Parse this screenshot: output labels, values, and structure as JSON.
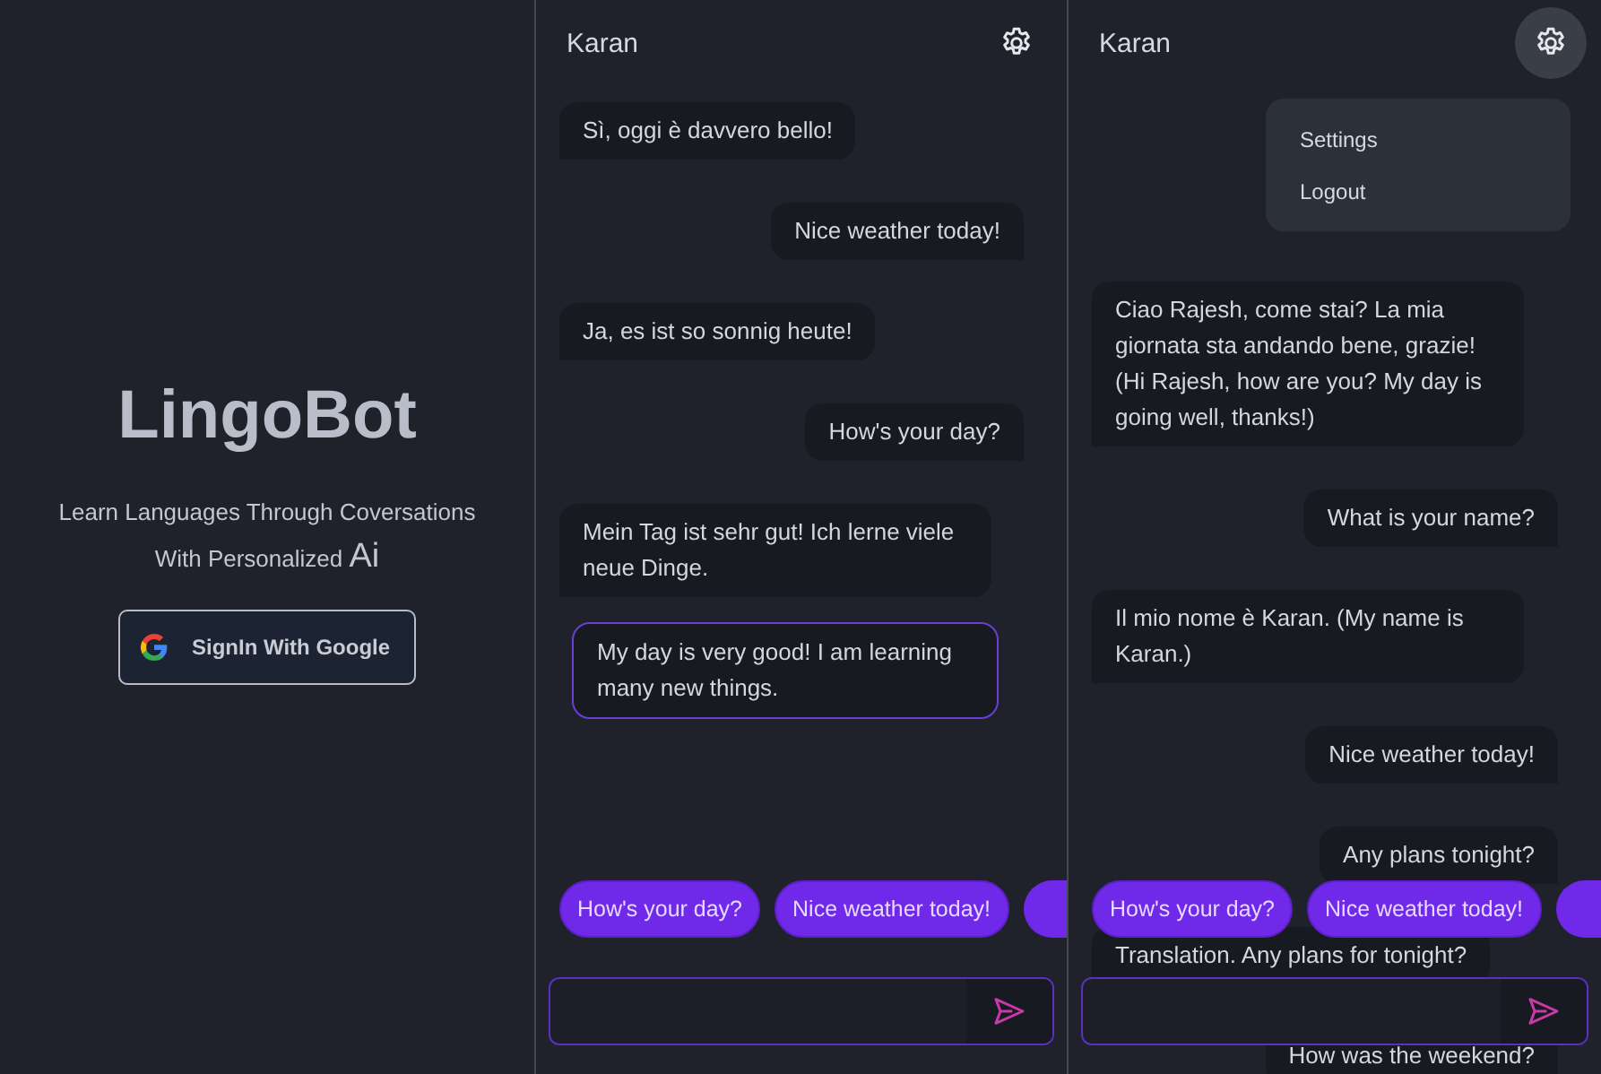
{
  "welcome": {
    "title": "LingoBot",
    "tagline": "Learn Languages Through Coversations With Personalized",
    "tagline_emphasis": "Ai",
    "signin_button": "SignIn With Google"
  },
  "chats": [
    {
      "contact": "Karan",
      "menu_open": false,
      "suggestions_overflow": true,
      "messages": [
        {
          "kind": "received",
          "text": "Sì, oggi è davvero bello!"
        },
        {
          "kind": "sent",
          "text": "Nice weather today!"
        },
        {
          "kind": "received",
          "text": "Ja, es ist so sonnig heute!"
        },
        {
          "kind": "sent",
          "text": "How's your day?"
        },
        {
          "kind": "received",
          "text": "Mein Tag ist sehr gut! Ich lerne viele neue Dinge."
        },
        {
          "kind": "translation",
          "text": "My day is very good! I am learning many new things."
        }
      ],
      "suggestions": [
        "How's your day?",
        "Nice weather today!"
      ]
    },
    {
      "contact": "Karan",
      "menu_open": true,
      "menu": [
        "Settings",
        "Logout"
      ],
      "suggestions_overflow": true,
      "messages": [
        {
          "kind": "received",
          "text": "Ciao Rajesh, come stai? La mia giornata sta andando bene, grazie! (Hi Rajesh, how are you? My day is going well, thanks!)"
        },
        {
          "kind": "sent",
          "text": "What is your name?"
        },
        {
          "kind": "received",
          "text": "Il mio nome è Karan. (My name is Karan.)"
        },
        {
          "kind": "sent",
          "text": "Nice weather today!"
        },
        {
          "kind": "sent",
          "text": "Any plans tonight?"
        },
        {
          "kind": "received",
          "text": "Translation. Any plans for tonight?"
        },
        {
          "kind": "sent",
          "text": "How was the weekend?"
        }
      ],
      "suggestions": [
        "How's your day?",
        "Nice weather today!"
      ]
    }
  ]
}
